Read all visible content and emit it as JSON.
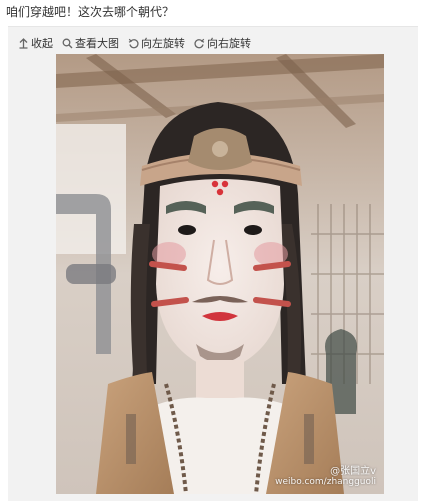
{
  "post": {
    "text": "咱们穿越吧！这次去哪个朝代？"
  },
  "toolbar": {
    "collapse_label": "收起",
    "view_large_label": "查看大图",
    "rotate_left_label": "向左旋转",
    "rotate_right_label": "向右旋转"
  },
  "photo": {
    "watermark_name": "@张国立v",
    "watermark_url": "weibo.com/zhangguoli"
  }
}
